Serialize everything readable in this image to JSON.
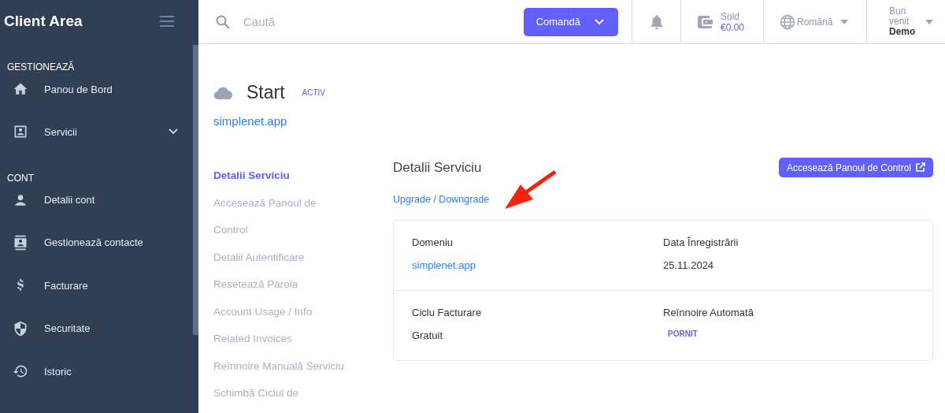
{
  "sidebar": {
    "title": "Client Area",
    "sections": [
      {
        "heading": "GESTIONEAZĂ",
        "items": [
          {
            "label": "Panou de Bord"
          },
          {
            "label": "Servicii",
            "expanded": false
          }
        ]
      },
      {
        "heading": "CONT",
        "items": [
          {
            "label": "Detalii cont"
          },
          {
            "label": "Gestionează contacte"
          },
          {
            "label": "Facturare"
          },
          {
            "label": "Securitate"
          },
          {
            "label": "Istoric"
          }
        ]
      }
    ]
  },
  "topbar": {
    "search": {
      "placeholder": "Caută"
    },
    "order_button": "Comandă",
    "balance": {
      "label": "Sold",
      "value": "€0.00"
    },
    "language": "Română",
    "user": {
      "greeting": "Bun venit",
      "name": "Demo"
    }
  },
  "service": {
    "title": "Start",
    "status": "ACTIV",
    "domain": "simplenet.app"
  },
  "service_nav": [
    {
      "label": "Detalii Serviciu",
      "selected": true
    },
    {
      "label": "Accesează Panoul de Control",
      "selected": false
    },
    {
      "label": "Detalii Autentificare",
      "selected": false
    },
    {
      "label": "Resetează Parola",
      "selected": false
    },
    {
      "label": "Account Usage / Info",
      "selected": false
    },
    {
      "label": "Related Invoices",
      "selected": false
    },
    {
      "label": "Reînnoire Manuală Serviciu",
      "selected": false
    },
    {
      "label": "Schimbă Ciclul de",
      "selected": false
    }
  ],
  "details": {
    "title": "Detalii Serviciu",
    "control_panel_button": "Accesează Panoul de Control",
    "upgrade_link": "Upgrade / Downgrade",
    "rows": [
      [
        {
          "label": "Domeniu",
          "value": "simplenet.app",
          "kind": "link"
        },
        {
          "label": "Data Înregistrării",
          "value": "25.11.2024",
          "kind": "text"
        }
      ],
      [
        {
          "label": "Ciclu Facturare",
          "value": "Gratuit",
          "kind": "text"
        },
        {
          "label": "Reînnoire Automată",
          "value": "PORNIT",
          "kind": "badge"
        }
      ]
    ]
  }
}
